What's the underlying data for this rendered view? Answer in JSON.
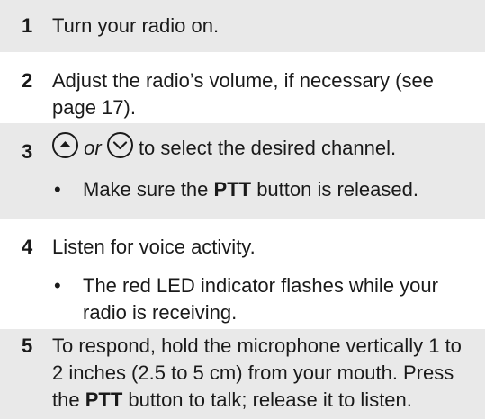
{
  "steps": [
    {
      "number": "1",
      "text": "Turn your radio on."
    },
    {
      "number": "2",
      "text_line1": "Adjust the radio’s volume, if necessary (see",
      "text_line2": "page 17)."
    },
    {
      "number": "3",
      "or": "or",
      "text": "to select the desired channel.",
      "up_icon": "up-arrow-button-icon",
      "down_icon": "down-arrow-button-icon",
      "bullet": {
        "symbol": "•",
        "pre": "Make sure the ",
        "bold": "PTT",
        "post": " button is released."
      }
    },
    {
      "number": "4",
      "text": "Listen for voice activity.",
      "bullet": {
        "symbol": "•",
        "line1": "The red LED indicator flashes while your",
        "line2": "radio is receiving."
      }
    },
    {
      "number": "5",
      "line1": "To respond, hold the microphone vertically 1 to",
      "line2": "2 inches (2.5 to 5 cm) from your mouth. Press",
      "line3_pre": "the ",
      "line3_bold": "PTT",
      "line3_post": " button to talk; release it to listen."
    }
  ],
  "colors": {
    "shade": "#e9e9e9",
    "text": "#1a1a1a"
  }
}
